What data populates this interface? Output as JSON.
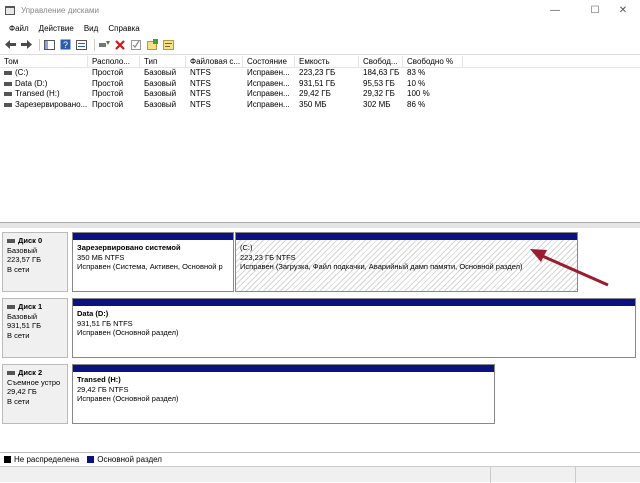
{
  "window": {
    "title": "Управление дисками",
    "minimize": "—",
    "maximize": "☐",
    "close": "✕"
  },
  "menu": [
    "Файл",
    "Действие",
    "Вид",
    "Справка"
  ],
  "toolbar_icons": [
    "back-arrow-icon",
    "forward-arrow-icon",
    "console-tree-icon",
    "help-icon",
    "properties-icon",
    "connect-icon",
    "delete-icon",
    "check-icon",
    "new-volume-icon",
    "rescan-icon"
  ],
  "table": {
    "columns": [
      "Том",
      "Располо...",
      "Тип",
      "Файловая с...",
      "Состояние",
      "Емкость",
      "Свобод...",
      "Свободно %"
    ],
    "rows": [
      [
        "(C:)",
        "Простой",
        "Базовый",
        "NTFS",
        "Исправен...",
        "223,23 ГБ",
        "184,63 ГБ",
        "83 %"
      ],
      [
        "Data (D:)",
        "Простой",
        "Базовый",
        "NTFS",
        "Исправен...",
        "931,51 ГБ",
        "95,53 ГБ",
        "10 %"
      ],
      [
        "Transed (H:)",
        "Простой",
        "Базовый",
        "NTFS",
        "Исправен...",
        "29,42 ГБ",
        "29,32 ГБ",
        "100 %"
      ],
      [
        "Зарезервировано...",
        "Простой",
        "Базовый",
        "NTFS",
        "Исправен...",
        "350 МБ",
        "302 МБ",
        "86 %"
      ]
    ]
  },
  "disks": [
    {
      "name": "Диск 0",
      "type": "Базовый",
      "size": "223,57 ГБ",
      "status": "В сети",
      "partitions": [
        {
          "name": "Зарезервировано системой",
          "size": "350 МБ NTFS",
          "status": "Исправен (Система, Активен, Основной р"
        },
        {
          "name": "(C:)",
          "size": "223,23 ГБ NTFS",
          "status": "Исправен (Загрузка, Файл подкачки, Аварийный дамп памяти, Основной раздел)"
        }
      ]
    },
    {
      "name": "Диск 1",
      "type": "Базовый",
      "size": "931,51 ГБ",
      "status": "В сети",
      "partitions": [
        {
          "name": "Data  (D:)",
          "size": "931,51 ГБ NTFS",
          "status": "Исправен (Основной раздел)"
        }
      ]
    },
    {
      "name": "Диск 2",
      "type": "Съемное устро",
      "size": "29,42 ГБ",
      "status": "В сети",
      "partitions": [
        {
          "name": "Transed  (H:)",
          "size": "29,42 ГБ NTFS",
          "status": "Исправен (Основной раздел)"
        }
      ]
    }
  ],
  "legend": [
    {
      "label": "Не распределена",
      "color": "#000000"
    },
    {
      "label": "Основной раздел",
      "color": "#0c1180"
    }
  ],
  "annotation_color": "#9b1b30"
}
